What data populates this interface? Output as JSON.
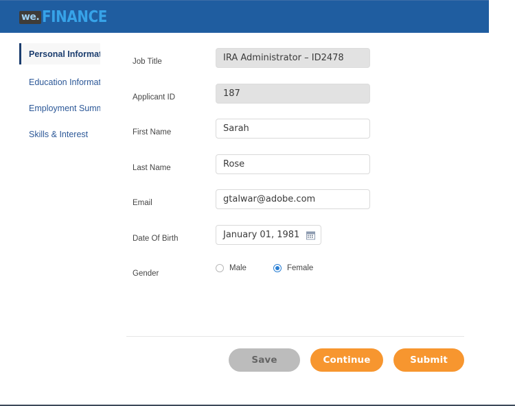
{
  "header": {
    "logo_mark": "we.",
    "logo_word": "FINANCE",
    "bg_color": "#1f5da0",
    "logo_word_color": "#37a3e8"
  },
  "sidebar": {
    "items": [
      {
        "label": "Personal Information",
        "active": true
      },
      {
        "label": "Education Information",
        "active": false
      },
      {
        "label": "Employment Summary",
        "active": false
      },
      {
        "label": "Skills & Interest",
        "active": false
      }
    ]
  },
  "form": {
    "fields": [
      {
        "label": "Job Title",
        "value": "IRA Administrator – ID2478",
        "placeholder": "",
        "state": "disabled",
        "type": "text"
      },
      {
        "label": "Applicant ID",
        "value": "187",
        "placeholder": "",
        "state": "disabled",
        "type": "text"
      },
      {
        "label": "First Name",
        "value": "Sarah",
        "placeholder": "",
        "state": "editable",
        "type": "text"
      },
      {
        "label": "Last Name",
        "value": "Rose",
        "placeholder": "",
        "state": "editable",
        "type": "text"
      },
      {
        "label": "Email",
        "value": "gtalwar@adobe.com",
        "placeholder": "",
        "state": "editable",
        "type": "text"
      },
      {
        "label": "Date Of Birth",
        "value": "January 01, 1981",
        "placeholder": "",
        "state": "editable",
        "type": "date",
        "icon": "calendar-icon"
      }
    ],
    "gender": {
      "label": "Gender",
      "options": [
        {
          "label": "Male",
          "checked": false
        },
        {
          "label": "Female",
          "checked": true
        }
      ],
      "selected_color": "#2a7fd4"
    }
  },
  "actions": {
    "save_label": "Save",
    "continue_label": "Continue",
    "submit_label": "Submit",
    "save_color": "#bcbcbc",
    "primary_color": "#f7962f"
  }
}
